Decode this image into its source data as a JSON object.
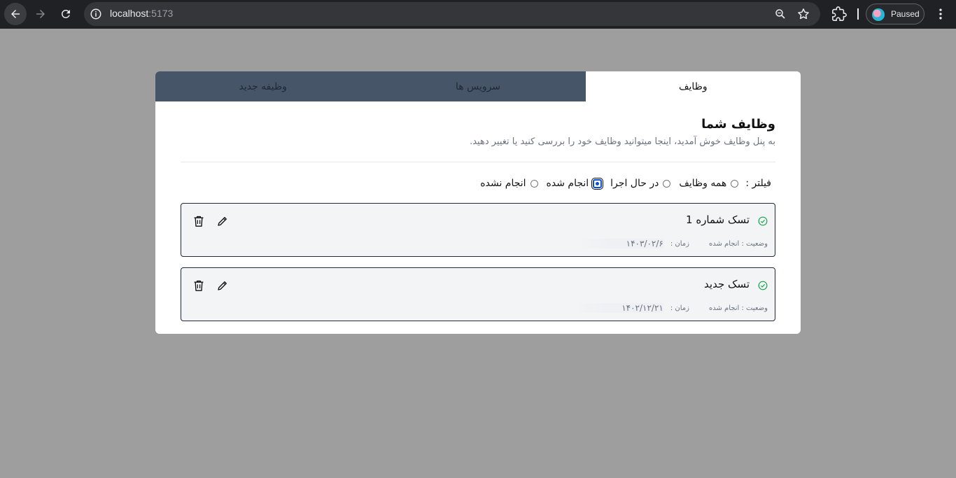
{
  "browser": {
    "url_host": "localhost",
    "url_port": ":5173",
    "profile_status": "Paused",
    "icons": [
      "back-arrow-icon",
      "forward-arrow-icon",
      "reload-icon",
      "site-info-icon",
      "zoom-icon",
      "bookmark-star-icon",
      "extensions-icon",
      "more-vert-icon"
    ]
  },
  "tabs": [
    {
      "label": "وظایف",
      "active": true
    },
    {
      "label": "سرویس ها",
      "active": false
    },
    {
      "label": "وظیفه جدید",
      "active": false
    }
  ],
  "header": {
    "title": "وظایف شما",
    "subtitle": "به پنل وظایف خوش آمدید، اینجا میتوانید وظایف خود را بررسی کنید یا تغییر دهید."
  },
  "filter": {
    "label": "فیلتر :",
    "options": [
      {
        "label": "همه وظایف",
        "checked": false
      },
      {
        "label": "در حال اجرا",
        "checked": false
      },
      {
        "label": "انجام شده",
        "checked": true
      },
      {
        "label": "انجام نشده",
        "checked": false
      }
    ]
  },
  "tasks": [
    {
      "title": "تسک شماره 1",
      "status": "وضعیت : انجام شده",
      "time_label": "زمان :",
      "date": "۱۴۰۳/۰۲/۶"
    },
    {
      "title": "تسک جدید",
      "status": "وضعیت : انجام شده",
      "time_label": "زمان :",
      "date": "۱۴۰۲/۱۲/۲۱"
    }
  ],
  "colors": {
    "page_bg": "#9e9e9e",
    "tab_inactive": "#475569",
    "task_border": "#1f2937",
    "check_green": "#16a34a",
    "radio_checked": "#0a4fd6"
  }
}
